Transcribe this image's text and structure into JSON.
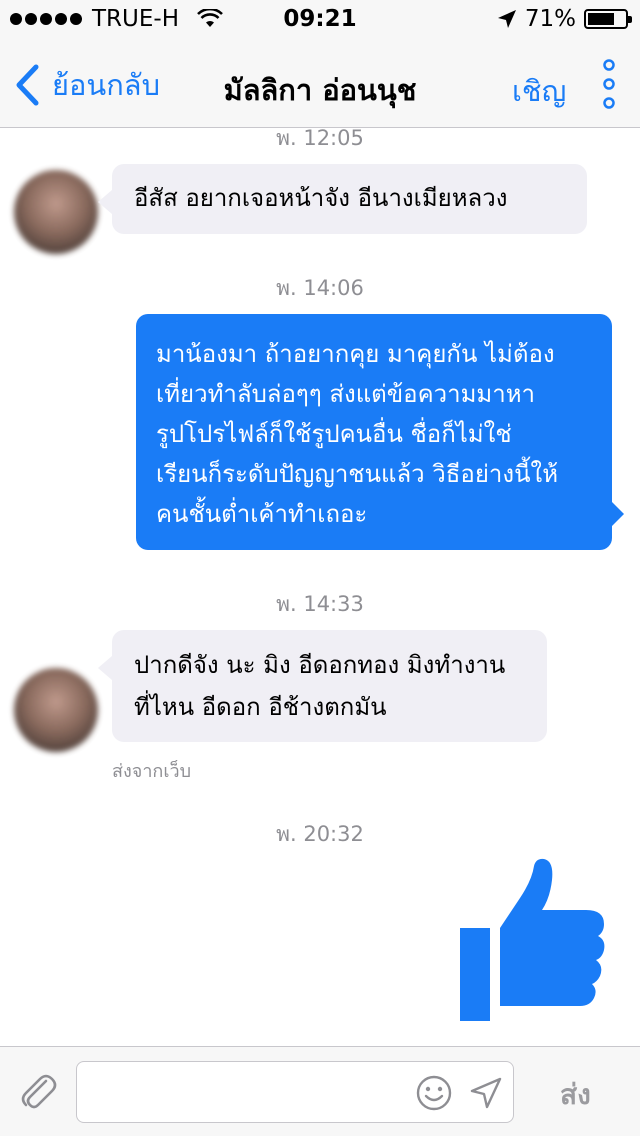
{
  "status_bar": {
    "carrier": "TRUE-H",
    "time": "09:21",
    "battery": "71%",
    "battery_level": 0.71
  },
  "nav": {
    "back_label": "ย้อนกลับ",
    "title": "มัลลิกา อ่อนนุช",
    "invite_label": "เชิญ"
  },
  "messages": {
    "ts_0": "พ. 12:05",
    "msg_1": "อีสัส อยากเจอหน้าจัง อีนางเมียหลวง",
    "ts_1": "พ. 14:06",
    "msg_2": "มาน้องมา ถ้าอยากคุย มาคุยกัน ไม่ต้อง\nเที่ยวทำลับล่อๆๆ ส่งแต่ข้อความมาหา\nรูปโปรไฟล์ก็ใช้รูปคนอื่น ชื่อก็ไม่ใช่\nเรียนก็ระดับปัญญาชนแล้ว วิธีอย่างนี้ให้\nคนชั้นต่ำเค้าทำเถอะ",
    "ts_2": "พ. 14:33",
    "msg_3": "ปากดีจัง นะ มิง อีดอกทอง มิงทำงาน\nที่ไหน อีดอก อีช้างตกมัน",
    "sent_from": "ส่งจากเว็บ",
    "ts_3": "พ. 20:32"
  },
  "input": {
    "value": "",
    "send_label": "ส่ง"
  },
  "colors": {
    "accent": "#1a7cf6",
    "incoming_bubble": "#f0eff5",
    "timestamp": "#8e8e93"
  },
  "icons": [
    "back-chevron-icon",
    "wifi-icon",
    "location-arrow-icon",
    "more-dots-icon",
    "like-thumb-icon",
    "paperclip-icon",
    "emoji-icon",
    "location-send-icon"
  ]
}
